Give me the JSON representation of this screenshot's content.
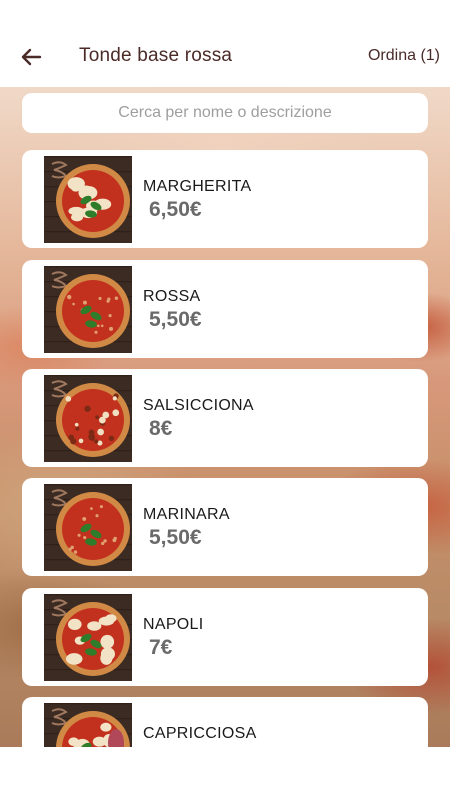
{
  "header": {
    "title": "Tonde base rossa",
    "order_label": "Ordina (1)"
  },
  "search": {
    "placeholder": "Cerca per nome o descrizione"
  },
  "products": [
    {
      "name": "MARGHERITA",
      "price": "6,50€",
      "topping": "margherita"
    },
    {
      "name": "ROSSA",
      "price": "5,50€",
      "topping": "rossa"
    },
    {
      "name": "SALSICCIONA",
      "price": "8€",
      "topping": "salsiccia"
    },
    {
      "name": "MARINARA",
      "price": "5,50€",
      "topping": "marinara"
    },
    {
      "name": "NAPOLI",
      "price": "7€",
      "topping": "napoli"
    },
    {
      "name": "CAPRICCIOSA",
      "price": "",
      "topping": "capricciosa"
    }
  ],
  "colors": {
    "header_text": "#4a2b28",
    "card_bg": "#ffffff",
    "price_text": "#6a6a6a"
  },
  "icons": {
    "back": "arrow-left-icon",
    "nav_back": "triangle-back-icon",
    "nav_home": "circle-home-icon",
    "nav_recent": "square-recent-icon"
  }
}
